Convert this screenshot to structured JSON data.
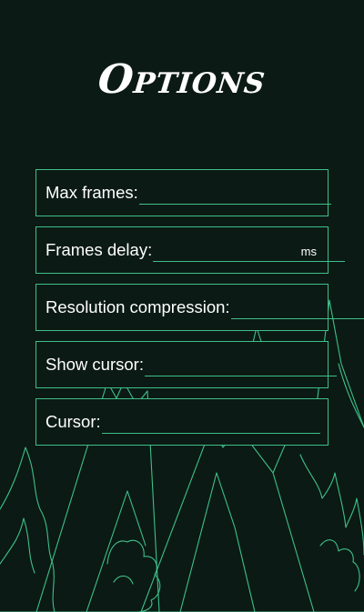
{
  "screen": {
    "title": "Options"
  },
  "form": {
    "fields": [
      {
        "label": "Max frames:",
        "value": "",
        "suffix": ""
      },
      {
        "label": "Frames delay:",
        "value": "",
        "suffix": "ms"
      },
      {
        "label": "Resolution compression:",
        "value": "",
        "suffix": ""
      },
      {
        "label": "Show cursor:",
        "value": "",
        "suffix": ""
      },
      {
        "label": "Cursor:",
        "value": "",
        "suffix": ""
      }
    ]
  },
  "theme": {
    "background": "#0b1a14",
    "accent": "#3fbf8a",
    "text": "#ffffff"
  }
}
